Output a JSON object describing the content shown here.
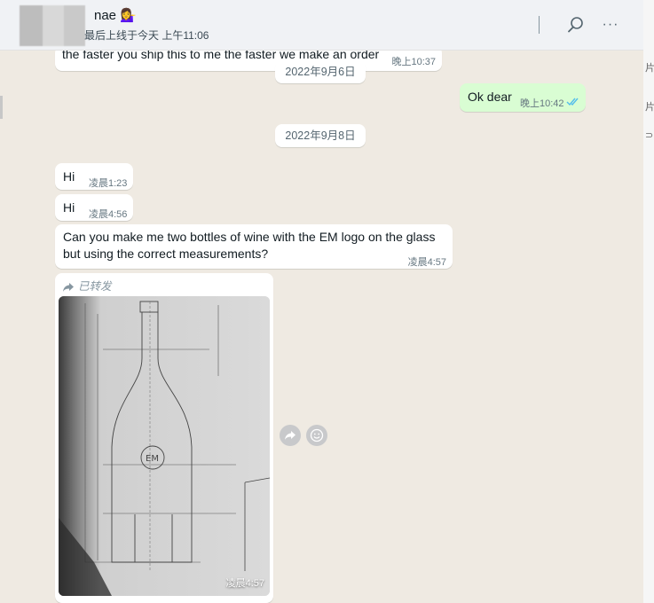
{
  "header": {
    "contact_name": "nae",
    "contact_emoji": "💁‍♀️",
    "last_seen": "最后上线于今天 上午11:06",
    "search_icon": "search-icon",
    "menu_icon": "more-icon",
    "menu_label": "···"
  },
  "messages": [
    {
      "dir": "in",
      "text": "the faster you ship this to me the faster we make an order",
      "time": "晚上10:37"
    },
    {
      "type": "date",
      "text": "2022年9月6日"
    },
    {
      "dir": "out",
      "text": "Ok dear",
      "time": "晚上10:42",
      "status": "read"
    },
    {
      "type": "date",
      "text": "2022年9月8日"
    },
    {
      "dir": "in",
      "text": "Hi",
      "time": "凌晨1:23"
    },
    {
      "dir": "in",
      "text": "Hi",
      "time": "凌晨4:56"
    },
    {
      "dir": "in",
      "text": "Can you make me two bottles of wine with the EM logo on the glass but using the correct measurements?",
      "time": "凌晨4:57"
    },
    {
      "dir": "in",
      "type": "image",
      "forwarded_label": "已转发",
      "time": "凌晨4:57"
    }
  ],
  "image_actions": {
    "forward_icon": "forward-icon",
    "emoji_icon": "emoji-icon"
  },
  "right_strip": [
    "片",
    "片",
    "⊃ 技"
  ],
  "colors": {
    "chat_bg": "#efeae2",
    "incoming": "#ffffff",
    "outgoing": "#d9fdd3",
    "read_ticks": "#53bdeb"
  }
}
